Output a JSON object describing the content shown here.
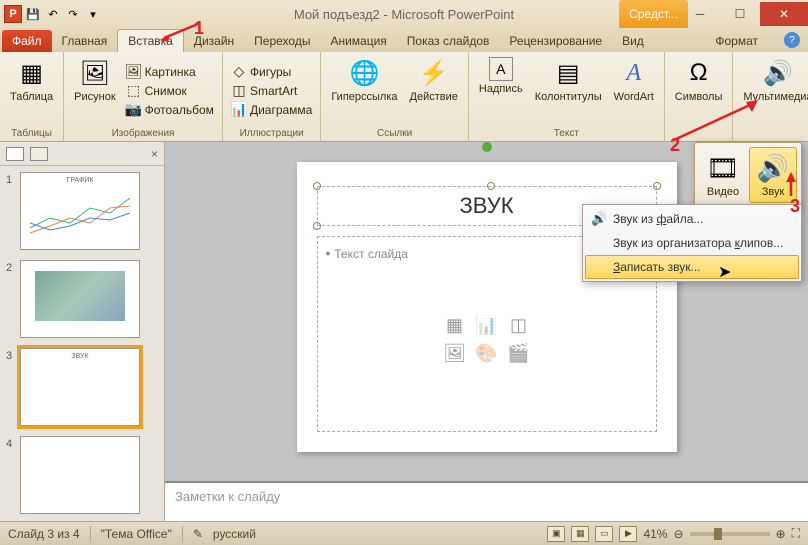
{
  "titlebar": {
    "title": "Мой подъезд2 - Microsoft PowerPoint",
    "tools": "Средст..."
  },
  "tabs": {
    "file": "Файл",
    "home": "Главная",
    "insert": "Вставка",
    "design": "Дизайн",
    "transitions": "Переходы",
    "animations": "Анимация",
    "slideshow": "Показ слайдов",
    "review": "Рецензирование",
    "view": "Вид",
    "format": "Формат"
  },
  "ribbon": {
    "tables": {
      "table": "Таблица",
      "group": "Таблицы"
    },
    "images": {
      "picture": "Рисунок",
      "clipart": "Картинка",
      "screenshot": "Снимок",
      "album": "Фотоальбом",
      "group": "Изображения"
    },
    "illus": {
      "shapes": "Фигуры",
      "smartart": "SmartArt",
      "chart": "Диаграмма",
      "group": "Иллюстрации"
    },
    "links": {
      "hyperlink": "Гиперссылка",
      "action": "Действие",
      "group": "Ссылки"
    },
    "text": {
      "textbox": "Надпись",
      "headerfooter": "Колонтитулы",
      "wordart": "WordArt",
      "group": "Текст"
    },
    "symbols": {
      "symbols": "Символы"
    },
    "media": {
      "media": "Мультимедиа"
    }
  },
  "media_panel": {
    "video": "Видео",
    "audio": "Звук"
  },
  "audio_menu": {
    "from_file": "Звук из файла...",
    "from_organizer": "Звук из организатора клипов...",
    "record": "Записать звук..."
  },
  "slide": {
    "title": "ЗВУК",
    "body": "Текст слайда"
  },
  "notes": {
    "placeholder": "Заметки к слайду"
  },
  "status": {
    "slide": "Слайд 3 из 4",
    "theme": "\"Тема Office\"",
    "lang": "русский",
    "zoom": "41%"
  },
  "thumbs": {
    "t1": "ГРАФИК",
    "t3": "ЗВУК"
  },
  "anno": {
    "n1": "1",
    "n2": "2",
    "n3": "3"
  }
}
